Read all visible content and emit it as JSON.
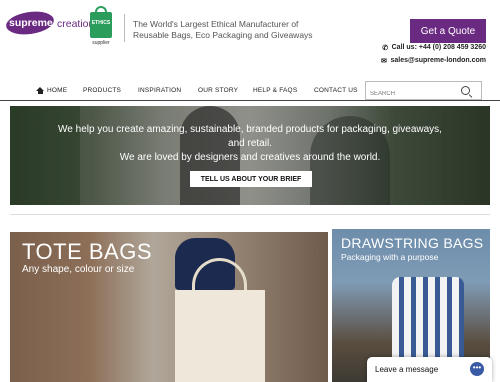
{
  "brand": {
    "logo_word1": "supreme",
    "logo_word2": "creations",
    "ethics_label": "ETHICS",
    "ethics_sub": "supplier",
    "tagline": "The World's Largest Ethical Manufacturer of Reusable Bags, Eco Packaging and Giveaways",
    "purple": "#6b2a82"
  },
  "header": {
    "cta_label": "Get a Quote",
    "phone": "Call us: +44 (0) 208 459 3260",
    "email": "sales@supreme-london.com",
    "phone_icon": "phone-icon",
    "email_icon": "envelope-icon"
  },
  "nav": {
    "items": [
      {
        "label": "HOME",
        "icon": "home-icon"
      },
      {
        "label": "PRODUCTS"
      },
      {
        "label": "INSPIRATION"
      },
      {
        "label": "OUR STORY"
      },
      {
        "label": "HELP & FAQS"
      },
      {
        "label": "CONTACT US"
      }
    ],
    "search_placeholder": "SEARCH",
    "search_icon": "search-icon"
  },
  "hero": {
    "line1": "We help you create amazing, sustainable, branded products for packaging, giveaways,",
    "line2": "and retail.",
    "line3": "We are loved by designers and creatives around the world.",
    "button_label": "TELL US ABOUT YOUR BRIEF"
  },
  "tiles": [
    {
      "title": "TOTE BAGS",
      "subtitle": "Any shape, colour or size"
    },
    {
      "title": "DRAWSTRING BAGS",
      "subtitle": "Packaging with a purpose"
    }
  ],
  "chat": {
    "label": "Leave a message",
    "icon": "chat-icon"
  }
}
